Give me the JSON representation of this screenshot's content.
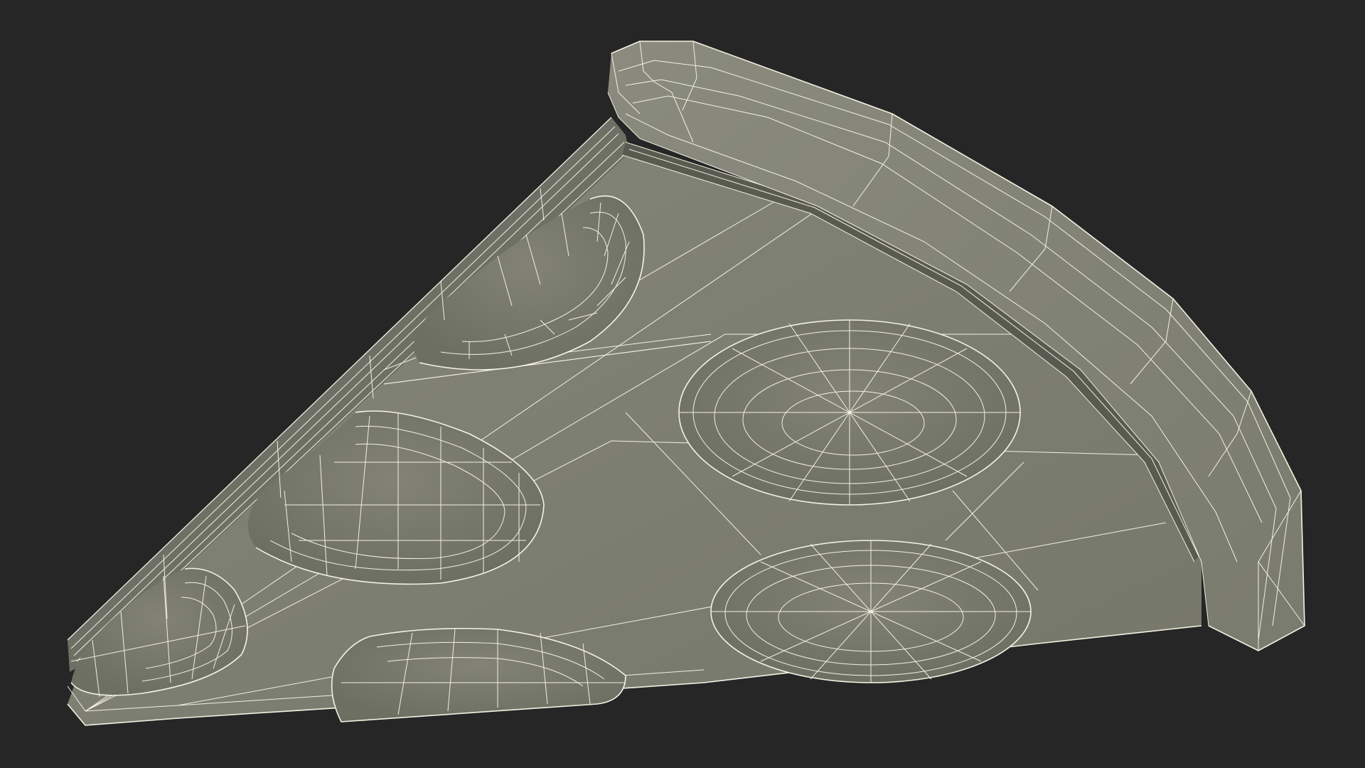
{
  "scene": {
    "subject": "pizza-slice-wireframe",
    "render_style": "wireframe-over-clay",
    "colors": {
      "background": "#262626",
      "surface": "#7c7d70",
      "surface_shadow": "#5e5f55",
      "surface_light": "#8b8c7f",
      "wire": "#f2f0e0"
    },
    "pepperoni_count": 6
  }
}
